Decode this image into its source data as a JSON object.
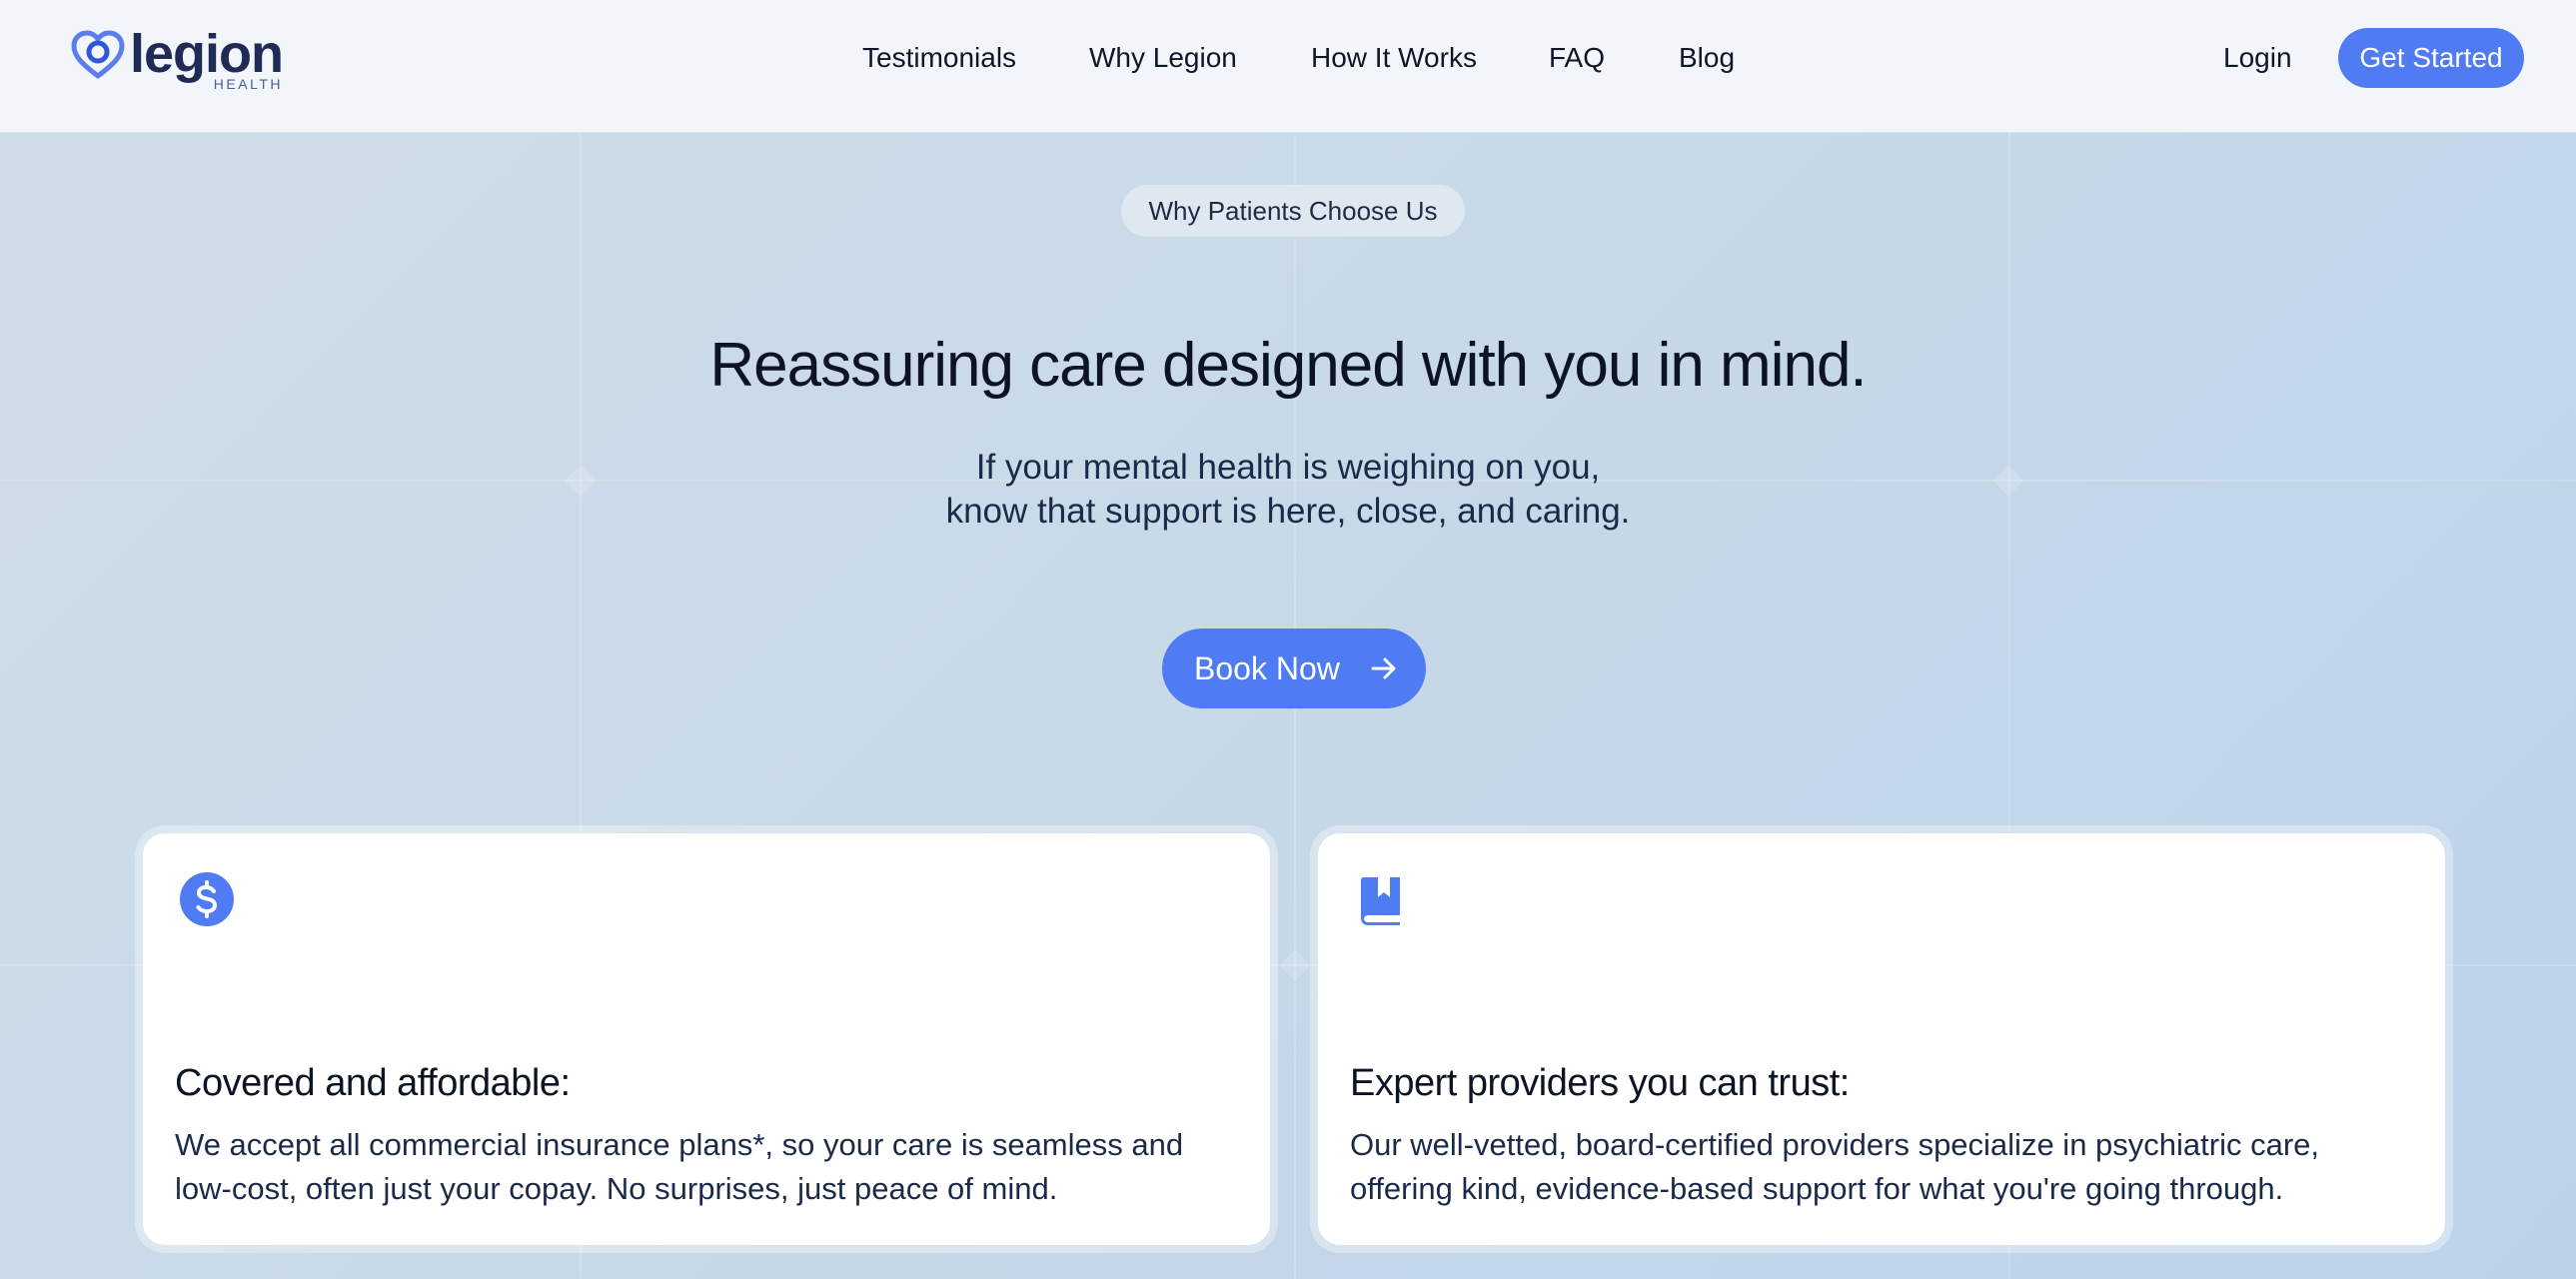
{
  "brand": {
    "name": "legion",
    "sub": "HEALTH",
    "accent": "#4f7cf2"
  },
  "nav": {
    "links": [
      "Testimonials",
      "Why Legion",
      "How It Works",
      "FAQ",
      "Blog"
    ],
    "login": "Login",
    "cta": "Get Started"
  },
  "hero": {
    "eyebrow": "Why Patients Choose Us",
    "title": "Reassuring care designed with you in mind.",
    "subtitle_lines": [
      "If your mental health is weighing on you,",
      "know that support is here, close, and caring."
    ],
    "cta": "Book Now",
    "cta_icon": "arrow-right-icon"
  },
  "cards": [
    {
      "icon": "dollar-circle-icon",
      "title": "Covered and affordable:",
      "body": "We accept all commercial insurance plans*, so your care is seamless and low-cost, often just your copay. No surprises, just peace of mind."
    },
    {
      "icon": "book-bookmark-icon",
      "title": "Expert providers you can trust:",
      "body": "Our well-vetted, board-certified providers specialize in psychiatric care, offering kind, evidence-based support for what you're going through."
    }
  ]
}
